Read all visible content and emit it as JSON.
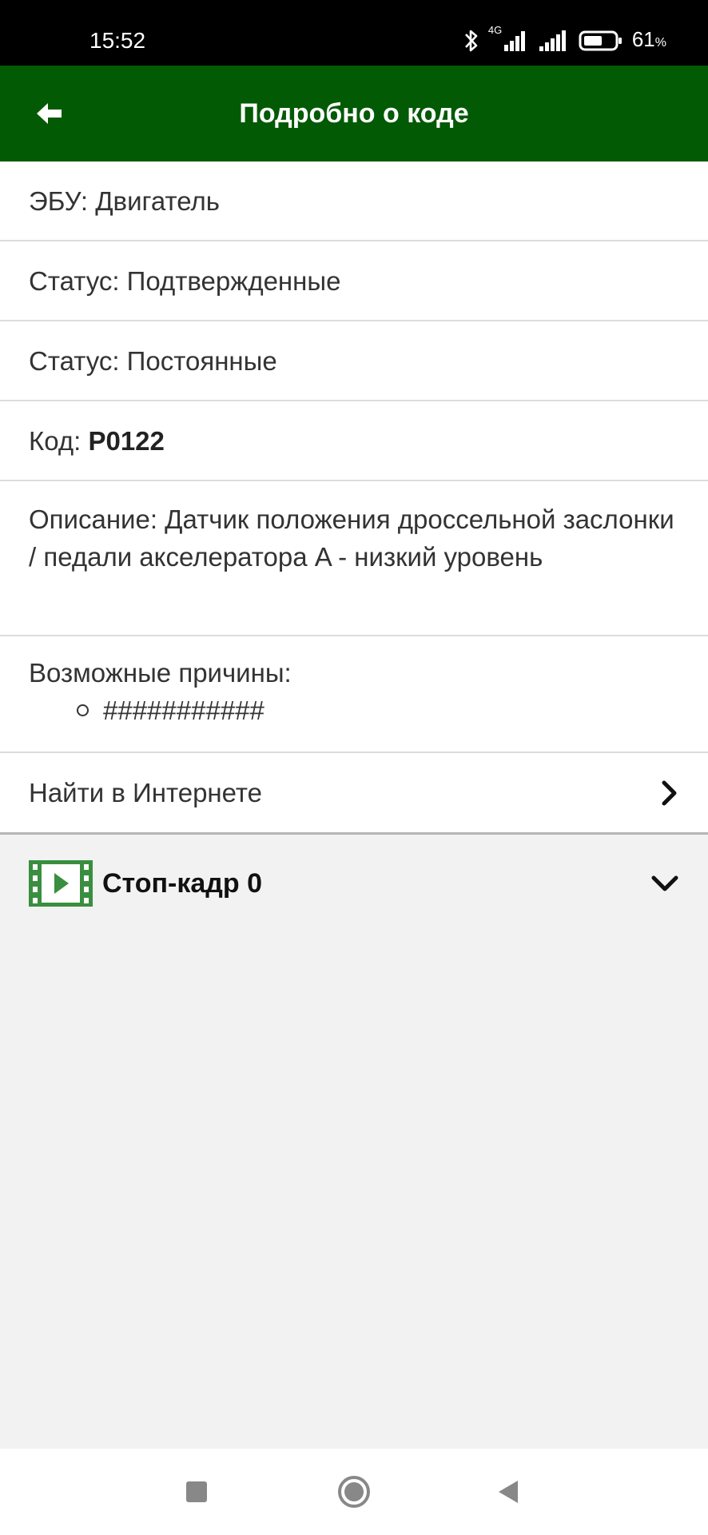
{
  "status_bar": {
    "time": "15:52",
    "network_label": "4G",
    "battery_percent": "61",
    "battery_unit": "%",
    "battery_level": 0.61,
    "icons": [
      "bluetooth-icon",
      "signal-icon",
      "signal-icon",
      "battery-icon"
    ]
  },
  "app_bar": {
    "title": "Подробно о коде",
    "back_icon": "arrow-left-icon",
    "background_color": "#035a05"
  },
  "details": {
    "ecu": "ЭБУ: Двигатель",
    "status_confirmed": "Статус: Подтвержденные",
    "status_permanent": "Статус: Постоянные",
    "code_label": "Код: ",
    "code_value": "P0122",
    "description": "Описание: Датчик положения дроссельной заслонки / педали акселератора A - низкий уровень",
    "causes_label": "Возможные причины:",
    "causes": [
      "###########"
    ]
  },
  "search_link": {
    "label": "Найти в Интернете",
    "icon": "chevron-right-icon"
  },
  "freeze_frame": {
    "label": "Стоп-кадр 0",
    "icon": "film-play-icon",
    "toggle_icon": "chevron-down-icon",
    "accent_color": "#3a8e3f"
  },
  "nav_bar": {
    "icons": [
      "recent-apps-icon",
      "home-icon",
      "back-icon"
    ]
  }
}
